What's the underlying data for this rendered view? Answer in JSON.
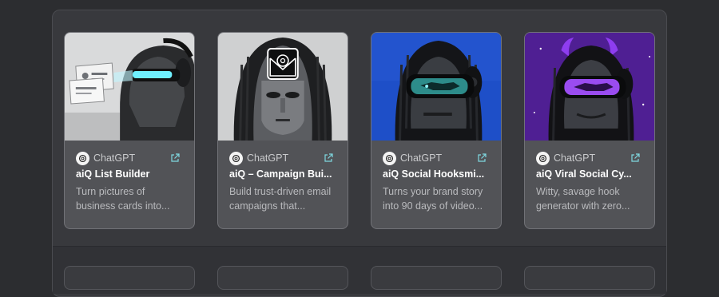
{
  "cards": [
    {
      "source": "ChatGPT",
      "title": "aiQ List Builder",
      "desc": [
        "Turn pictures of",
        "business cards into..."
      ]
    },
    {
      "source": "ChatGPT",
      "title": "aiQ – Campaign Bui...",
      "desc": [
        "Build trust-driven email",
        "campaigns that..."
      ]
    },
    {
      "source": "ChatGPT",
      "title": "aiQ Social Hooksmi...",
      "desc": [
        "Turns your brand story",
        "into 90 days of video..."
      ]
    },
    {
      "source": "ChatGPT",
      "title": "aiQ Viral Social Cy...",
      "desc": [
        "Witty, savage hook",
        "generator with zero..."
      ]
    }
  ],
  "colors": {
    "page": "#2c2d30",
    "panel": "#38393d",
    "card": "#525357",
    "accent_cyan": "#4fe3ff",
    "accent_purple": "#b45cff"
  }
}
